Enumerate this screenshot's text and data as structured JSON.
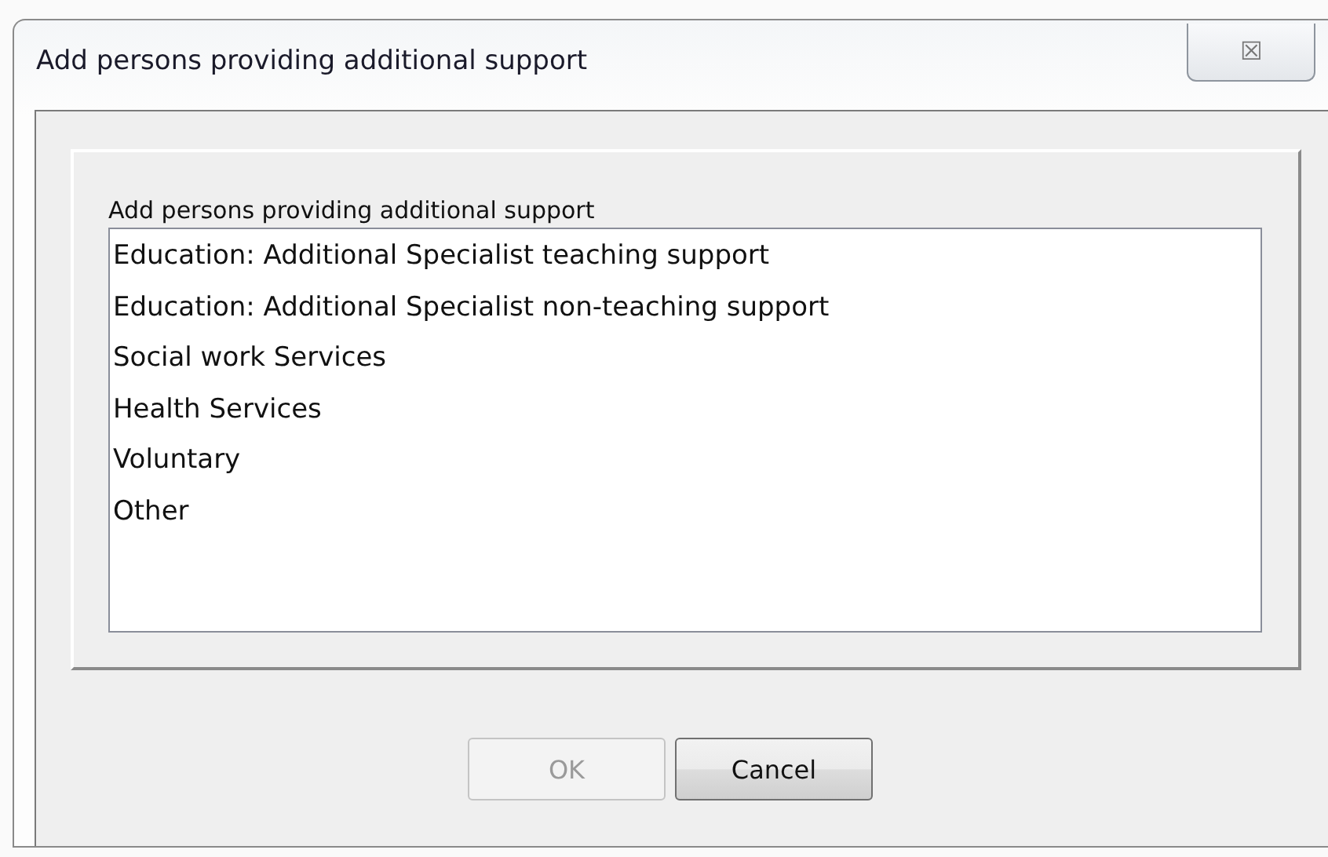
{
  "window": {
    "title": "Add persons providing additional support",
    "close": "☒"
  },
  "list": {
    "label": "Add persons providing additional support",
    "items": [
      {
        "text": "Education: Additional Specialist teaching support",
        "selected": false
      },
      {
        "text": "Education: Additional Specialist non-teaching support",
        "selected": false
      },
      {
        "text": "Social work Services",
        "selected": false
      },
      {
        "text": "Health Services",
        "selected": false
      },
      {
        "text": "Voluntary",
        "selected": false
      },
      {
        "text": "Other",
        "selected": false
      }
    ]
  },
  "buttons": [
    {
      "label": "OK",
      "disabled": true
    },
    {
      "label": "Cancel",
      "disabled": false
    }
  ]
}
